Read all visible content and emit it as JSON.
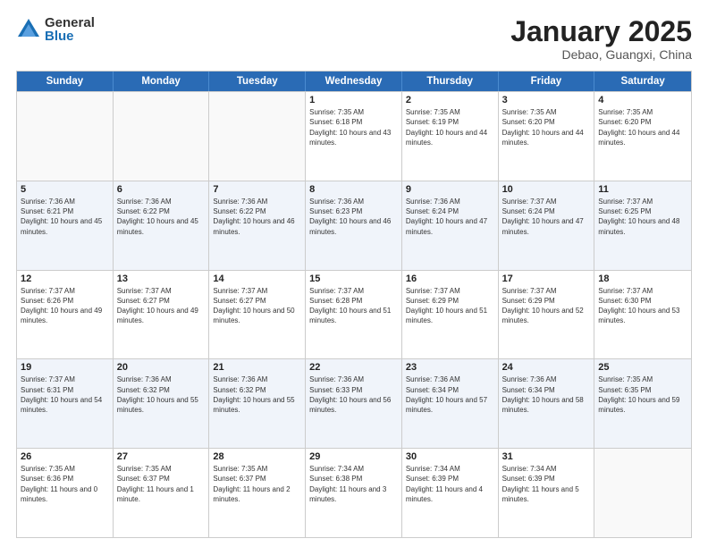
{
  "logo": {
    "general": "General",
    "blue": "Blue"
  },
  "header": {
    "month": "January 2025",
    "location": "Debao, Guangxi, China"
  },
  "dayHeaders": [
    "Sunday",
    "Monday",
    "Tuesday",
    "Wednesday",
    "Thursday",
    "Friday",
    "Saturday"
  ],
  "weeks": [
    [
      {
        "date": "",
        "sunrise": "",
        "sunset": "",
        "daylight": ""
      },
      {
        "date": "",
        "sunrise": "",
        "sunset": "",
        "daylight": ""
      },
      {
        "date": "",
        "sunrise": "",
        "sunset": "",
        "daylight": ""
      },
      {
        "date": "1",
        "sunrise": "Sunrise: 7:35 AM",
        "sunset": "Sunset: 6:18 PM",
        "daylight": "Daylight: 10 hours and 43 minutes."
      },
      {
        "date": "2",
        "sunrise": "Sunrise: 7:35 AM",
        "sunset": "Sunset: 6:19 PM",
        "daylight": "Daylight: 10 hours and 44 minutes."
      },
      {
        "date": "3",
        "sunrise": "Sunrise: 7:35 AM",
        "sunset": "Sunset: 6:20 PM",
        "daylight": "Daylight: 10 hours and 44 minutes."
      },
      {
        "date": "4",
        "sunrise": "Sunrise: 7:35 AM",
        "sunset": "Sunset: 6:20 PM",
        "daylight": "Daylight: 10 hours and 44 minutes."
      }
    ],
    [
      {
        "date": "5",
        "sunrise": "Sunrise: 7:36 AM",
        "sunset": "Sunset: 6:21 PM",
        "daylight": "Daylight: 10 hours and 45 minutes."
      },
      {
        "date": "6",
        "sunrise": "Sunrise: 7:36 AM",
        "sunset": "Sunset: 6:22 PM",
        "daylight": "Daylight: 10 hours and 45 minutes."
      },
      {
        "date": "7",
        "sunrise": "Sunrise: 7:36 AM",
        "sunset": "Sunset: 6:22 PM",
        "daylight": "Daylight: 10 hours and 46 minutes."
      },
      {
        "date": "8",
        "sunrise": "Sunrise: 7:36 AM",
        "sunset": "Sunset: 6:23 PM",
        "daylight": "Daylight: 10 hours and 46 minutes."
      },
      {
        "date": "9",
        "sunrise": "Sunrise: 7:36 AM",
        "sunset": "Sunset: 6:24 PM",
        "daylight": "Daylight: 10 hours and 47 minutes."
      },
      {
        "date": "10",
        "sunrise": "Sunrise: 7:37 AM",
        "sunset": "Sunset: 6:24 PM",
        "daylight": "Daylight: 10 hours and 47 minutes."
      },
      {
        "date": "11",
        "sunrise": "Sunrise: 7:37 AM",
        "sunset": "Sunset: 6:25 PM",
        "daylight": "Daylight: 10 hours and 48 minutes."
      }
    ],
    [
      {
        "date": "12",
        "sunrise": "Sunrise: 7:37 AM",
        "sunset": "Sunset: 6:26 PM",
        "daylight": "Daylight: 10 hours and 49 minutes."
      },
      {
        "date": "13",
        "sunrise": "Sunrise: 7:37 AM",
        "sunset": "Sunset: 6:27 PM",
        "daylight": "Daylight: 10 hours and 49 minutes."
      },
      {
        "date": "14",
        "sunrise": "Sunrise: 7:37 AM",
        "sunset": "Sunset: 6:27 PM",
        "daylight": "Daylight: 10 hours and 50 minutes."
      },
      {
        "date": "15",
        "sunrise": "Sunrise: 7:37 AM",
        "sunset": "Sunset: 6:28 PM",
        "daylight": "Daylight: 10 hours and 51 minutes."
      },
      {
        "date": "16",
        "sunrise": "Sunrise: 7:37 AM",
        "sunset": "Sunset: 6:29 PM",
        "daylight": "Daylight: 10 hours and 51 minutes."
      },
      {
        "date": "17",
        "sunrise": "Sunrise: 7:37 AM",
        "sunset": "Sunset: 6:29 PM",
        "daylight": "Daylight: 10 hours and 52 minutes."
      },
      {
        "date": "18",
        "sunrise": "Sunrise: 7:37 AM",
        "sunset": "Sunset: 6:30 PM",
        "daylight": "Daylight: 10 hours and 53 minutes."
      }
    ],
    [
      {
        "date": "19",
        "sunrise": "Sunrise: 7:37 AM",
        "sunset": "Sunset: 6:31 PM",
        "daylight": "Daylight: 10 hours and 54 minutes."
      },
      {
        "date": "20",
        "sunrise": "Sunrise: 7:36 AM",
        "sunset": "Sunset: 6:32 PM",
        "daylight": "Daylight: 10 hours and 55 minutes."
      },
      {
        "date": "21",
        "sunrise": "Sunrise: 7:36 AM",
        "sunset": "Sunset: 6:32 PM",
        "daylight": "Daylight: 10 hours and 55 minutes."
      },
      {
        "date": "22",
        "sunrise": "Sunrise: 7:36 AM",
        "sunset": "Sunset: 6:33 PM",
        "daylight": "Daylight: 10 hours and 56 minutes."
      },
      {
        "date": "23",
        "sunrise": "Sunrise: 7:36 AM",
        "sunset": "Sunset: 6:34 PM",
        "daylight": "Daylight: 10 hours and 57 minutes."
      },
      {
        "date": "24",
        "sunrise": "Sunrise: 7:36 AM",
        "sunset": "Sunset: 6:34 PM",
        "daylight": "Daylight: 10 hours and 58 minutes."
      },
      {
        "date": "25",
        "sunrise": "Sunrise: 7:35 AM",
        "sunset": "Sunset: 6:35 PM",
        "daylight": "Daylight: 10 hours and 59 minutes."
      }
    ],
    [
      {
        "date": "26",
        "sunrise": "Sunrise: 7:35 AM",
        "sunset": "Sunset: 6:36 PM",
        "daylight": "Daylight: 11 hours and 0 minutes."
      },
      {
        "date": "27",
        "sunrise": "Sunrise: 7:35 AM",
        "sunset": "Sunset: 6:37 PM",
        "daylight": "Daylight: 11 hours and 1 minute."
      },
      {
        "date": "28",
        "sunrise": "Sunrise: 7:35 AM",
        "sunset": "Sunset: 6:37 PM",
        "daylight": "Daylight: 11 hours and 2 minutes."
      },
      {
        "date": "29",
        "sunrise": "Sunrise: 7:34 AM",
        "sunset": "Sunset: 6:38 PM",
        "daylight": "Daylight: 11 hours and 3 minutes."
      },
      {
        "date": "30",
        "sunrise": "Sunrise: 7:34 AM",
        "sunset": "Sunset: 6:39 PM",
        "daylight": "Daylight: 11 hours and 4 minutes."
      },
      {
        "date": "31",
        "sunrise": "Sunrise: 7:34 AM",
        "sunset": "Sunset: 6:39 PM",
        "daylight": "Daylight: 11 hours and 5 minutes."
      },
      {
        "date": "",
        "sunrise": "",
        "sunset": "",
        "daylight": ""
      }
    ]
  ]
}
